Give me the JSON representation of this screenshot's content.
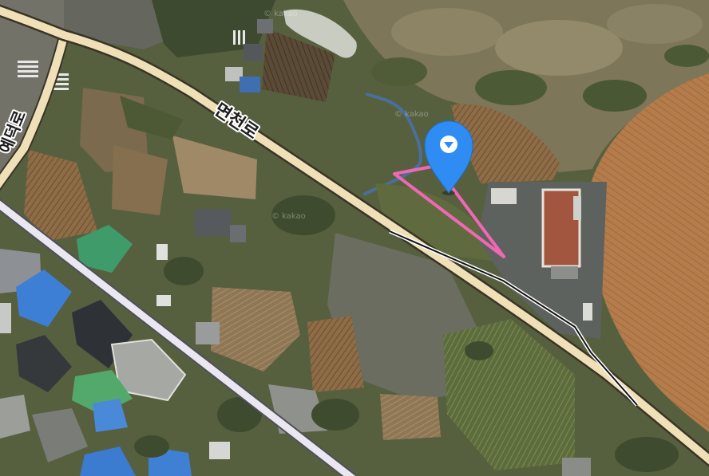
{
  "map": {
    "watermark": "© kakao",
    "road_labels": {
      "main": "면천로",
      "side": "예덕로"
    },
    "marker": {
      "icon": "map-pin-icon",
      "inner_icon": "chevron-down-icon",
      "color": "#2f8cf2"
    },
    "area_outline": {
      "color": "#f267b5"
    },
    "colors": {
      "main_road": "#efe0b8",
      "secondary_road": "#ebe7f1",
      "rail_line": "#121212"
    }
  }
}
